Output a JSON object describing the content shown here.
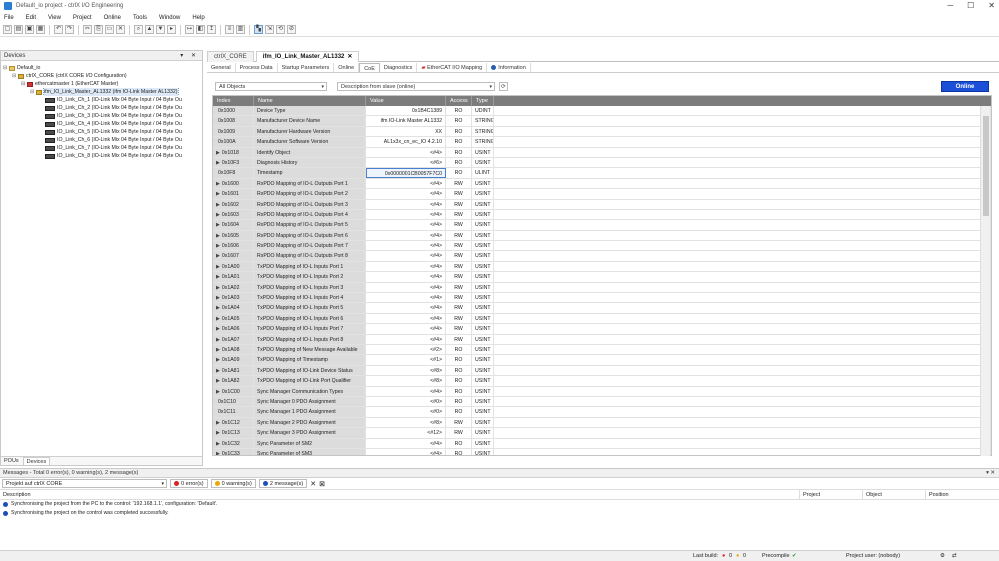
{
  "window": {
    "title": "Default_io project - ctrlX I/O Engineering",
    "controls": [
      "─",
      "☐",
      "✕"
    ]
  },
  "menu": [
    "File",
    "Edit",
    "View",
    "Project",
    "Online",
    "Tools",
    "Window",
    "Help"
  ],
  "devices_pane": {
    "title": "Devices",
    "controls": "▾ ✕",
    "tree": [
      {
        "label": "Default_io",
        "level": 0,
        "icon": "project"
      },
      {
        "label": "ctrlX_CORE (ctrlX CORE I/O Configuration)",
        "level": 1,
        "icon": "plc"
      },
      {
        "label": "ethercatmaster 1 (EtherCAT Master)",
        "level": 2,
        "icon": "dev"
      },
      {
        "label": "ifm_IO_Link_Master_AL1332 (ifm IO-Link Master AL1332)",
        "level": 3,
        "icon": "plc",
        "selected": true
      },
      {
        "label": "IO_Link_Ch_1 (IO-Link Mix 04 Byte Input / 04 Byte Ou",
        "level": 4,
        "icon": "io"
      },
      {
        "label": "IO_Link_Ch_2 (IO-Link Mix 04 Byte Input / 04 Byte Ou",
        "level": 4,
        "icon": "io"
      },
      {
        "label": "IO_Link_Ch_3 (IO-Link Mix 04 Byte Input / 04 Byte Ou",
        "level": 4,
        "icon": "io"
      },
      {
        "label": "IO_Link_Ch_4 (IO-Link Mix 04 Byte Input / 04 Byte Ou",
        "level": 4,
        "icon": "io"
      },
      {
        "label": "IO_Link_Ch_5 (IO-Link Mix 04 Byte Input / 04 Byte Ou",
        "level": 4,
        "icon": "io"
      },
      {
        "label": "IO_Link_Ch_6 (IO-Link Mix 04 Byte Input / 04 Byte Ou",
        "level": 4,
        "icon": "io"
      },
      {
        "label": "IO_Link_Ch_7 (IO-Link Mix 04 Byte Input / 04 Byte Ou",
        "level": 4,
        "icon": "io"
      },
      {
        "label": "IO_Link_Ch_8 (IO-Link Mix 04 Byte Input / 04 Byte Ou",
        "level": 4,
        "icon": "io"
      }
    ],
    "footer_tabs": [
      "POUs",
      "Devices"
    ]
  },
  "editor": {
    "tabs": [
      {
        "label": "ctrlX_CORE",
        "active": false
      },
      {
        "label": "ifm_IO_Link_Master_AL1332",
        "active": true
      }
    ],
    "subtabs": [
      "General",
      "Process Data",
      "Startup Parameters",
      "Online",
      "CoE",
      "Diagnostics",
      "EtherCAT I/O Mapping",
      "Information"
    ],
    "active_subtab": "CoE",
    "filter_objects": "All Objects",
    "filter_description": "Description from slave (online)",
    "online_button": "Online"
  },
  "coe_table": {
    "columns": [
      "Index",
      "Name",
      "Value",
      "Access",
      "Type"
    ],
    "rows": [
      {
        "idx": "0x1000",
        "name": "Device Type",
        "val": "0x1B4C1389",
        "acc": "RO",
        "typ": "UDINT",
        "exp": false
      },
      {
        "idx": "0x1008",
        "name": "Manufacturer Device Name",
        "val": "ifm IO-Link Master AL1332",
        "acc": "RO",
        "typ": "STRING",
        "exp": false
      },
      {
        "idx": "0x1009",
        "name": "Manufacturer Hardware Version",
        "val": "XX",
        "acc": "RO",
        "typ": "STRING",
        "exp": false
      },
      {
        "idx": "0x100A",
        "name": "Manufacturer Software Version",
        "val": "AL1x3x_cn_ec_IO 4.2.10",
        "acc": "RO",
        "typ": "STRING",
        "exp": false
      },
      {
        "idx": "0x1018",
        "name": "Identify Object",
        "val": "<#4>",
        "acc": "RO",
        "typ": "USINT",
        "exp": true
      },
      {
        "idx": "0x10F3",
        "name": "Diagnosis History",
        "val": "<#6>",
        "acc": "RO",
        "typ": "USINT",
        "exp": true
      },
      {
        "idx": "0x10F8",
        "name": "Timestamp",
        "val": "0x0000001CB0057F7C0",
        "acc": "RO",
        "typ": "ULINT",
        "exp": false,
        "hi": true
      },
      {
        "idx": "0x1600",
        "name": "RxPDO Mapping of IO-L Outputs Port 1",
        "val": "<#4>",
        "acc": "RW",
        "typ": "USINT",
        "exp": true
      },
      {
        "idx": "0x1601",
        "name": "RxPDO Mapping of IO-L Outputs Port 2",
        "val": "<#4>",
        "acc": "RW",
        "typ": "USINT",
        "exp": true
      },
      {
        "idx": "0x1602",
        "name": "RxPDO Mapping of IO-L Outputs Port 3",
        "val": "<#4>",
        "acc": "RW",
        "typ": "USINT",
        "exp": true
      },
      {
        "idx": "0x1603",
        "name": "RxPDO Mapping of IO-L Outputs Port 4",
        "val": "<#4>",
        "acc": "RW",
        "typ": "USINT",
        "exp": true
      },
      {
        "idx": "0x1604",
        "name": "RxPDO Mapping of IO-L Outputs Port 5",
        "val": "<#4>",
        "acc": "RW",
        "typ": "USINT",
        "exp": true
      },
      {
        "idx": "0x1605",
        "name": "RxPDO Mapping of IO-L Outputs Port 6",
        "val": "<#4>",
        "acc": "RW",
        "typ": "USINT",
        "exp": true
      },
      {
        "idx": "0x1606",
        "name": "RxPDO Mapping of IO-L Outputs Port 7",
        "val": "<#4>",
        "acc": "RW",
        "typ": "USINT",
        "exp": true
      },
      {
        "idx": "0x1607",
        "name": "RxPDO Mapping of IO-L Outputs Port 8",
        "val": "<#4>",
        "acc": "RW",
        "typ": "USINT",
        "exp": true
      },
      {
        "idx": "0x1A00",
        "name": "TxPDO Mapping of IO-L Inputs Port 1",
        "val": "<#4>",
        "acc": "RW",
        "typ": "USINT",
        "exp": true
      },
      {
        "idx": "0x1A01",
        "name": "TxPDO Mapping of IO-L Inputs Port 2",
        "val": "<#4>",
        "acc": "RW",
        "typ": "USINT",
        "exp": true
      },
      {
        "idx": "0x1A02",
        "name": "TxPDO Mapping of IO-L Inputs Port 3",
        "val": "<#4>",
        "acc": "RW",
        "typ": "USINT",
        "exp": true
      },
      {
        "idx": "0x1A03",
        "name": "TxPDO Mapping of IO-L Inputs Port 4",
        "val": "<#4>",
        "acc": "RW",
        "typ": "USINT",
        "exp": true
      },
      {
        "idx": "0x1A04",
        "name": "TxPDO Mapping of IO-L Inputs Port 5",
        "val": "<#4>",
        "acc": "RW",
        "typ": "USINT",
        "exp": true
      },
      {
        "idx": "0x1A05",
        "name": "TxPDO Mapping of IO-L Inputs Port 6",
        "val": "<#4>",
        "acc": "RW",
        "typ": "USINT",
        "exp": true
      },
      {
        "idx": "0x1A06",
        "name": "TxPDO Mapping of IO-L Inputs Port 7",
        "val": "<#4>",
        "acc": "RW",
        "typ": "USINT",
        "exp": true
      },
      {
        "idx": "0x1A07",
        "name": "TxPDO Mapping of IO-L Inputs Port 8",
        "val": "<#4>",
        "acc": "RW",
        "typ": "USINT",
        "exp": true
      },
      {
        "idx": "0x1A08",
        "name": "TxPDO Mapping of New Message Available",
        "val": "<#2>",
        "acc": "RO",
        "typ": "USINT",
        "exp": true
      },
      {
        "idx": "0x1A09",
        "name": "TxPDO Mapping of Timestamp",
        "val": "<#1>",
        "acc": "RO",
        "typ": "USINT",
        "exp": true
      },
      {
        "idx": "0x1A81",
        "name": "TxPDO Mapping of IO-Link Device Status",
        "val": "<#8>",
        "acc": "RO",
        "typ": "USINT",
        "exp": true
      },
      {
        "idx": "0x1A82",
        "name": "TxPDO Mapping of IO-Link Port Qualifier",
        "val": "<#8>",
        "acc": "RO",
        "typ": "USINT",
        "exp": true
      },
      {
        "idx": "0x1C00",
        "name": "Sync Manager Communication Types",
        "val": "<#4>",
        "acc": "RO",
        "typ": "USINT",
        "exp": true
      },
      {
        "idx": "0x1C10",
        "name": "Sync Manager 0 PDO Assignment",
        "val": "<#0>",
        "acc": "RO",
        "typ": "USINT",
        "exp": false
      },
      {
        "idx": "0x1C11",
        "name": "Sync Manager 1 PDO Assignment",
        "val": "<#0>",
        "acc": "RO",
        "typ": "USINT",
        "exp": false
      },
      {
        "idx": "0x1C12",
        "name": "Sync Manager 2 PDO Assignment",
        "val": "<#8>",
        "acc": "RW",
        "typ": "USINT",
        "exp": true
      },
      {
        "idx": "0x1C13",
        "name": "Sync Manager 3 PDO Assignment",
        "val": "<#12>",
        "acc": "RW",
        "typ": "USINT",
        "exp": true
      },
      {
        "idx": "0x1C32",
        "name": "Sync Parameter of SM2",
        "val": "<#4>",
        "acc": "RO",
        "typ": "USINT",
        "exp": true
      },
      {
        "idx": "0x1C33",
        "name": "Sync Parameter of SM3",
        "val": "<#4>",
        "acc": "RO",
        "typ": "USINT",
        "exp": true
      }
    ]
  },
  "messages": {
    "title": "Messages - Total 0 error(s), 0 warning(s), 2 message(s)",
    "controls": "▾ ✕",
    "filter": "Projekt auf ctrlX CORE",
    "errors": "0 error(s)",
    "warnings": "0 warning(s)",
    "infos": "2 message(s)",
    "columns": [
      "Description",
      "Project",
      "Object",
      "Position"
    ],
    "rows": [
      "Synchronising the project from the PC to the control: '192.168.1.1', configuration: 'Default'.",
      "Synchronising the project on the control was completed successfully."
    ]
  },
  "status": {
    "last_build": "Last build:",
    "err": "0",
    "warn": "0",
    "precompile": "Precompile",
    "user": "Project user: (nobody)"
  }
}
